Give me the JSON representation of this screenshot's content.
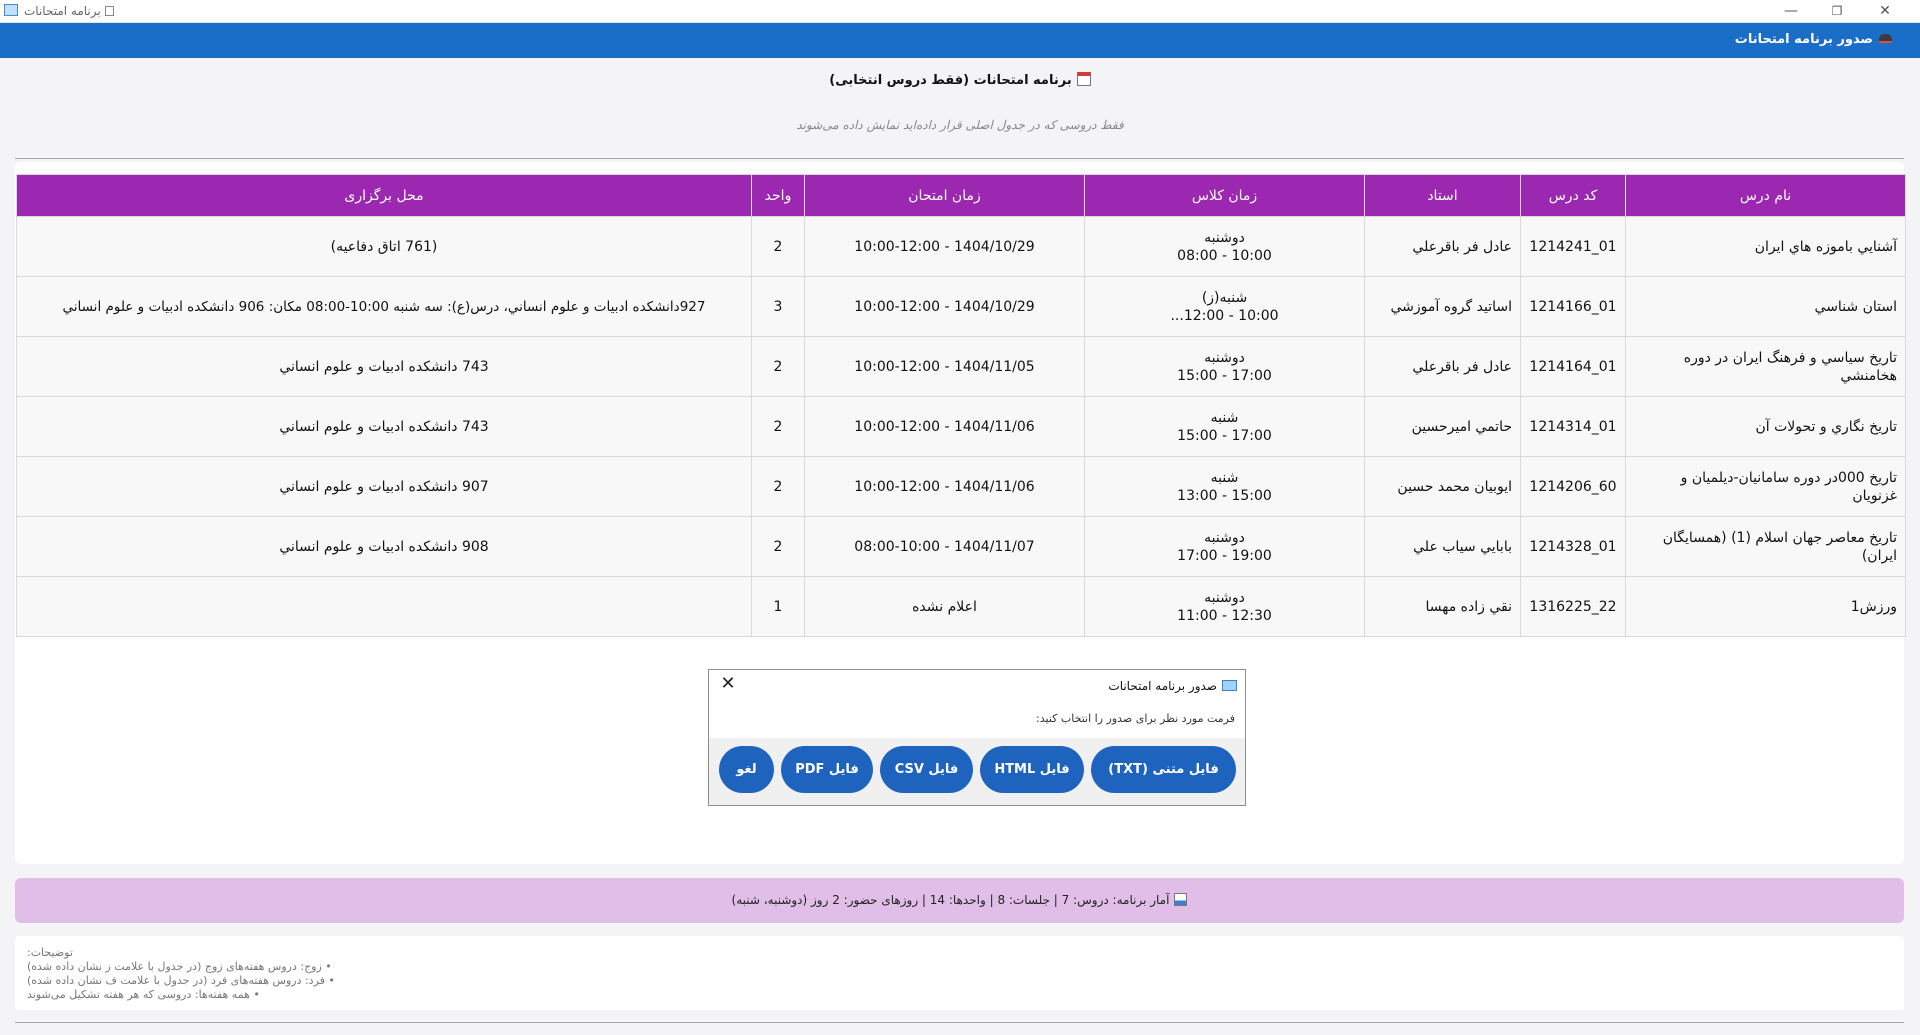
{
  "window": {
    "title": "برنامه امتحانات",
    "min": "—",
    "max": "❐",
    "close": "✕"
  },
  "header": {
    "title": "صدور برنامه امتحانات"
  },
  "page": {
    "title": "برنامه امتحانات (فقط دروس انتخابی)",
    "subtitle": "فقط دروسی که در جدول اصلی قرار داده‌اید نمایش داده می‌شوند"
  },
  "table": {
    "columns": [
      "نام درس",
      "کد درس",
      "استاد",
      "زمان کلاس",
      "زمان امتحان",
      "واحد",
      "محل برگزاری"
    ],
    "rows": [
      {
        "name": "آشنايي باموزه هاي ايران",
        "code": "01_1214241",
        "teacher": "عادل فر باقرعلي",
        "class_day": "دوشنبه",
        "class_time": "10:00 - 08:00",
        "exam": "1404/10/29 - 10:00-12:00",
        "units": "2",
        "place": "(761 اتاق دفاعیه)"
      },
      {
        "name": "استان شناسي",
        "code": "01_1214166",
        "teacher": "اساتيد گروه آموزشي",
        "class_day": "شنبه(ز)",
        "class_time": "10:00 - 12:00...",
        "exam": "1404/10/29 - 10:00-12:00",
        "units": "3",
        "place": "927دانشکده ادبيات و علوم انساني، درس(ع): سه شنبه    10:00-08:00 مکان: 906 دانشکده ادبيات و علوم انساني"
      },
      {
        "name": "تاريخ سياسي و فرهنگ ايران در دوره هخامنشي",
        "code": "01_1214164",
        "teacher": "عادل فر باقرعلي",
        "class_day": "دوشنبه",
        "class_time": "17:00 - 15:00",
        "exam": "1404/11/05 - 10:00-12:00",
        "units": "2",
        "place": "743 دانشکده ادبيات و علوم انساني"
      },
      {
        "name": "تاريخ نگاري و تحولات آن",
        "code": "01_1214314",
        "teacher": "حاتمي اميرحسين",
        "class_day": "شنبه",
        "class_time": "17:00 - 15:00",
        "exam": "1404/11/06 - 10:00-12:00",
        "units": "2",
        "place": "743 دانشکده ادبيات و علوم انساني"
      },
      {
        "name": "تاريخ 000در دوره سامانيان-ديلميان و غزنويان",
        "code": "60_1214206",
        "teacher": "ايوبيان محمد حسين",
        "class_day": "شنبه",
        "class_time": "15:00 - 13:00",
        "exam": "1404/11/06 - 10:00-12:00",
        "units": "2",
        "place": "907 دانشکده ادبيات و علوم انساني"
      },
      {
        "name": "تاريخ معاصر جهان اسلام (1) (همسايگان ايران)",
        "code": "01_1214328",
        "teacher": "بابايي سياب علي",
        "class_day": "دوشنبه",
        "class_time": "19:00 - 17:00",
        "exam": "1404/11/07 - 08:00-10:00",
        "units": "2",
        "place": "908 دانشکده ادبيات و علوم انساني"
      },
      {
        "name": "ورزش1",
        "code": "22_1316225",
        "teacher": "نقي زاده مهسا",
        "class_day": "دوشنبه",
        "class_time": "12:30 - 11:00",
        "exam": "اعلام نشده",
        "units": "1",
        "place": ""
      }
    ]
  },
  "dialog": {
    "title": "صدور برنامه امتحانات",
    "prompt": "فرمت مورد نظر برای صدور را انتخاب کنید:",
    "close": "✕",
    "buttons": {
      "cancel": "لغو",
      "pdf": "فایل PDF",
      "csv": "فایل CSV",
      "html": "فایل HTML",
      "txt": "فایل متنی (TXT)"
    }
  },
  "stats": {
    "text": "آمار برنامه: دروس: 7 | جلسات: 8 | واحدها: 14 | روزهای حضور: 2 روز (دوشنبه، شنبه)"
  },
  "notes": {
    "heading": "توضیحات:",
    "lines": [
      "• زوج: دروس هفته‌های زوج (در جدول با علامت ز نشان داده شده)",
      "• فرد: دروس هفته‌های فرد (در جدول با علامت ف نشان داده شده)",
      "• همه هفته‌ها: دروسی که هر هفته تشکیل می‌شوند"
    ]
  },
  "colors": {
    "header_blue": "#1a6ec7",
    "table_header_purple": "#9c27b0",
    "stats_bg": "#e1bee7",
    "button_blue": "#1e63be"
  }
}
